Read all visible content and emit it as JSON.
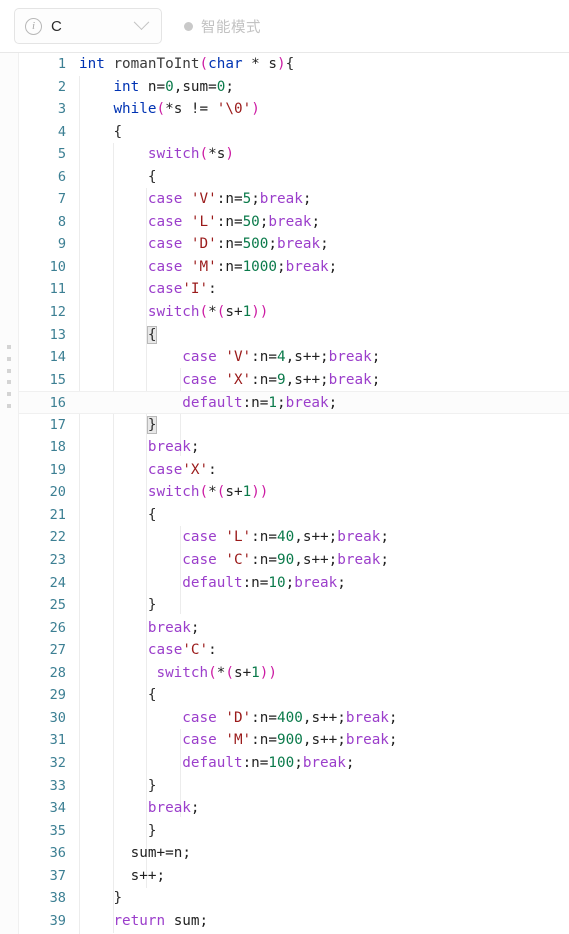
{
  "topbar": {
    "language_selector": {
      "icon": "info-icon",
      "value": "C",
      "chevron": "chevron-down-icon"
    },
    "mode": {
      "dot_color": "#c9c9c9",
      "label": "智能模式"
    }
  },
  "editor": {
    "active_line": 16,
    "colors": {
      "line_number": "#3c7f93",
      "keyword": "#0033b3",
      "control": "#9b3ecb",
      "punctuation": "#cc1ba3",
      "string": "#9a1a1a",
      "number": "#0a7a4a",
      "text": "#1f1f1f",
      "background": "#ffffff",
      "active_line_bg": "#fcfcfc",
      "indent_guide": "#ececec"
    },
    "lines": [
      {
        "n": "1",
        "text": "int romanToInt(char * s){"
      },
      {
        "n": "2",
        "text": "    int n=0,sum=0;"
      },
      {
        "n": "3",
        "text": "    while(*s != '\\0')"
      },
      {
        "n": "4",
        "text": "    {"
      },
      {
        "n": "5",
        "text": "        switch(*s)"
      },
      {
        "n": "6",
        "text": "        {"
      },
      {
        "n": "7",
        "text": "        case 'V':n=5;break;"
      },
      {
        "n": "8",
        "text": "        case 'L':n=50;break;"
      },
      {
        "n": "9",
        "text": "        case 'D':n=500;break;"
      },
      {
        "n": "10",
        "text": "        case 'M':n=1000;break;"
      },
      {
        "n": "11",
        "text": "        case'I':"
      },
      {
        "n": "12",
        "text": "        switch(*(s+1))"
      },
      {
        "n": "13",
        "text": "        {"
      },
      {
        "n": "14",
        "text": "            case 'V':n=4,s++;break;"
      },
      {
        "n": "15",
        "text": "            case 'X':n=9,s++;break;"
      },
      {
        "n": "16",
        "text": "            default:n=1;break;"
      },
      {
        "n": "17",
        "text": "        }"
      },
      {
        "n": "18",
        "text": "        break;"
      },
      {
        "n": "19",
        "text": "        case'X':"
      },
      {
        "n": "20",
        "text": "        switch(*(s+1))"
      },
      {
        "n": "21",
        "text": "        {"
      },
      {
        "n": "22",
        "text": "            case 'L':n=40,s++;break;"
      },
      {
        "n": "23",
        "text": "            case 'C':n=90,s++;break;"
      },
      {
        "n": "24",
        "text": "            default:n=10;break;"
      },
      {
        "n": "25",
        "text": "        }"
      },
      {
        "n": "26",
        "text": "        break;"
      },
      {
        "n": "27",
        "text": "        case'C':"
      },
      {
        "n": "28",
        "text": "         switch(*(s+1))"
      },
      {
        "n": "29",
        "text": "        {"
      },
      {
        "n": "30",
        "text": "            case 'D':n=400,s++;break;"
      },
      {
        "n": "31",
        "text": "            case 'M':n=900,s++;break;"
      },
      {
        "n": "32",
        "text": "            default:n=100;break;"
      },
      {
        "n": "33",
        "text": "        }"
      },
      {
        "n": "34",
        "text": "        break;"
      },
      {
        "n": "35",
        "text": "        }"
      },
      {
        "n": "36",
        "text": "      sum+=n;"
      },
      {
        "n": "37",
        "text": "      s++;"
      },
      {
        "n": "38",
        "text": "    }"
      },
      {
        "n": "39",
        "text": "    return sum;"
      }
    ]
  }
}
